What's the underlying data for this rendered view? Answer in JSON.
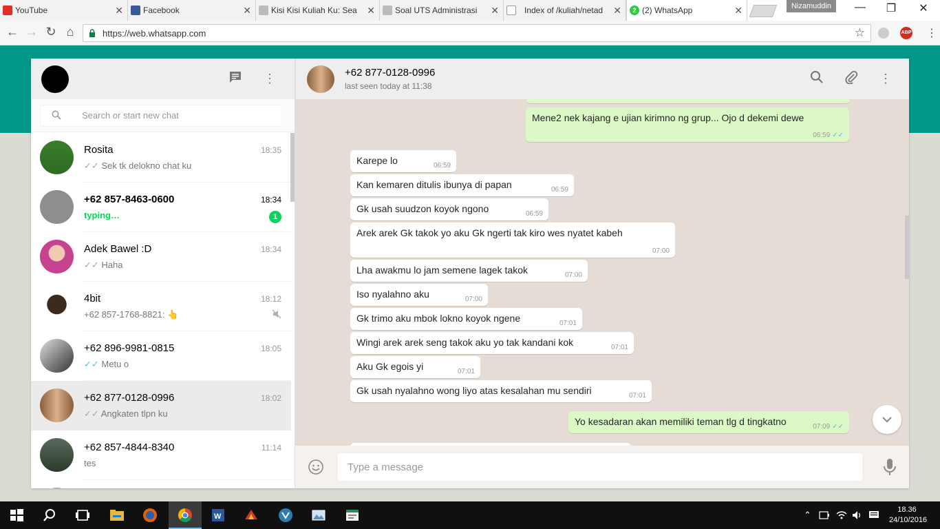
{
  "browser": {
    "tabs": [
      {
        "label": "YouTube",
        "icon": "youtube-icon",
        "color": "#e52d27"
      },
      {
        "label": "Facebook",
        "icon": "facebook-icon",
        "color": "#3b5998"
      },
      {
        "label": "Kisi Kisi Kuliah Ku: Sea",
        "icon": "wrench-icon",
        "color": "#777777"
      },
      {
        "label": "Soal UTS Administrasi",
        "icon": "wrench-icon",
        "color": "#777777"
      },
      {
        "label": "Index of /kuliah/netad",
        "icon": "page-icon",
        "color": "#999999"
      },
      {
        "label": "(2) WhatsApp",
        "icon": "whatsapp-icon",
        "color": "#2ecc40",
        "badge": "2",
        "active": true
      }
    ],
    "profile_name": "Nizamuddin",
    "url": "https://web.whatsapp.com",
    "window_controls": {
      "minimize": "—",
      "restore": "❐",
      "close": "✕"
    },
    "adblock_label": "ABP"
  },
  "sidebar": {
    "search_placeholder": "Search or start new chat",
    "chats": [
      {
        "name": "Rosita",
        "time": "18:35",
        "last": "Sek tk delokno chat ku",
        "ticks": "✓✓",
        "tick_color": "#a6a6a6"
      },
      {
        "name": "+62 857-8463-0600",
        "time": "18:34",
        "last": "typing…",
        "typing": true,
        "unread": "1"
      },
      {
        "name": "Adek Bawel :D",
        "time": "18:34",
        "last": "Haha",
        "ticks": "✓✓",
        "tick_color": "#a6a6a6"
      },
      {
        "name": "4bit",
        "time": "18:12",
        "last": "+62 857-1768-8821: 👆",
        "muted": true
      },
      {
        "name": "+62 896-9981-0815",
        "time": "18:05",
        "last": "Metu o",
        "ticks": "✓✓",
        "tick_color": "#4fc3f7"
      },
      {
        "name": "+62 877-0128-0996",
        "time": "18:02",
        "last": "Angkaten tlpn ku",
        "ticks": "✓✓",
        "tick_color": "#a6a6a6",
        "active": true
      },
      {
        "name": "+62 857-4844-8340",
        "time": "11:14",
        "last": "tes"
      }
    ]
  },
  "chat": {
    "contact_name": "+62 877-0128-0996",
    "status": "last seen today at 11:38",
    "messages": [
      {
        "text": "Mene2 nek kajang e ujian kirimno ng grup... Ojo d dekemi dewe",
        "time": "06:59",
        "out": true,
        "ticks": "✓✓"
      },
      {
        "text": "Karepe lo",
        "time": "06:59",
        "out": false
      },
      {
        "text": "Kan kemaren ditulis ibunya di papan",
        "time": "06:59",
        "out": false
      },
      {
        "text": "Gk usah suudzon koyok ngono",
        "time": "06:59",
        "out": false
      },
      {
        "text": "Arek arek Gk takok yo aku Gk ngerti tak kiro wes nyatet kabeh",
        "time": "07:00",
        "out": false
      },
      {
        "text": "Lha awakmu lo jam semene lagek takok",
        "time": "07:00",
        "out": false
      },
      {
        "text": "Iso nyalahno aku",
        "time": "07:00",
        "out": false
      },
      {
        "text": "Gk trimo aku mbok lokno koyok ngene",
        "time": "07:01",
        "out": false
      },
      {
        "text": "Wingi arek arek seng takok aku yo tak kandani kok",
        "time": "07:01",
        "out": false
      },
      {
        "text": "Aku Gk egois yi",
        "time": "07:01",
        "out": false
      },
      {
        "text": "Gk usah nyalahno wong liyo atas kesalahan mu sendiri",
        "time": "07:01",
        "out": false
      },
      {
        "text": "Yo kesadaran akan memiliki teman tlg d tingkatno",
        "time": "07:09",
        "out": true,
        "ticks": "✓✓"
      }
    ],
    "compose_placeholder": "Type a message"
  },
  "taskbar": {
    "apps": [
      "windows-start-icon",
      "search-icon",
      "task-view-icon",
      "file-explorer-icon",
      "firefox-icon",
      "chrome-icon",
      "word-icon",
      "app-icon",
      "app2-icon",
      "photos-icon",
      "app3-icon"
    ],
    "time": "18.36",
    "date": "24/10/2016"
  },
  "colors": {
    "teal": "#009688",
    "outgoing_bubble": "#dcf8c6",
    "chat_bg": "#e5ddd5",
    "unread_badge": "#09d261",
    "read_ticks": "#4fc3f7"
  }
}
